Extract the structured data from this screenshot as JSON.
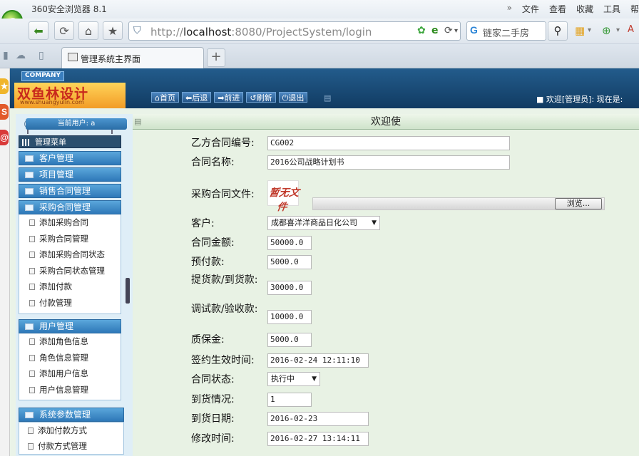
{
  "browser": {
    "app_title": "360安全浏览器 8.1",
    "menu": [
      "»",
      "文件",
      "查看",
      "收藏",
      "工具",
      "帮"
    ],
    "url_prefix": "http://",
    "url_host": "localhost",
    "url_rest": ":8080/ProjectSystem/login",
    "search_text": "链家二手房",
    "tab_title": "管理系统主界面",
    "new_tab": "+"
  },
  "header": {
    "company_badge": "COMPANY",
    "logo_text": "双鱼林设计",
    "logo_url": "www.shuangyulin.com",
    "toolbar": [
      "首页",
      "后退",
      "前进",
      "刷新",
      "退出"
    ],
    "welcome": "■ 欢迎[管理员]:  现在是: "
  },
  "sidebar": {
    "current_user": "当前用户: a",
    "menu_title": "管理菜单",
    "categories": [
      "客户管理",
      "项目管理",
      "销售合同管理",
      "采购合同管理"
    ],
    "purchase_items": [
      "添加采购合同",
      "采购合同管理",
      "添加采购合同状态",
      "采购合同状态管理",
      "添加付款",
      "付款管理"
    ],
    "user_category": "用户管理",
    "user_items": [
      "添加角色信息",
      "角色信息管理",
      "添加用户信息",
      "用户信息管理"
    ],
    "param_category": "系统参数管理",
    "param_items": [
      "添加付款方式",
      "付款方式管理"
    ]
  },
  "content": {
    "title": "欢迎使",
    "fields": {
      "contract_no_label": "乙方合同编号:",
      "contract_no": "CG002",
      "contract_name_label": "合同名称:",
      "contract_name": "2016公司战略计划书",
      "file_label": "采购合同文件:",
      "no_file": "暂无文件",
      "browse": "浏览...",
      "customer_label": "客户:",
      "customer": "成都喜洋洋商品日化公司",
      "amount_label": "合同金额:",
      "amount": "50000.0",
      "prepay_label": "预付款:",
      "prepay": "5000.0",
      "delivery_pay_label": "提货款/到货款:",
      "delivery_pay": "30000.0",
      "debug_pay_label": "调试款/验收款:",
      "debug_pay": "10000.0",
      "warranty_label": "质保金:",
      "warranty": "5000.0",
      "sign_time_label": "签约生效时间:",
      "sign_time": "2016-02-24 12:11:10",
      "status_label": "合同状态:",
      "status": "执行中",
      "arrival_label": "到货情况:",
      "arrival": "1",
      "arrival_date_label": "到货日期:",
      "arrival_date": "2016-02-23",
      "modify_time_label": "修改时间:",
      "modify_time": "2016-02-27 13:14:11"
    }
  },
  "colors": {
    "header_blue": "#1a4a78",
    "menu_blue": "#2e78b8",
    "content_bg": "#e8f2e4"
  }
}
